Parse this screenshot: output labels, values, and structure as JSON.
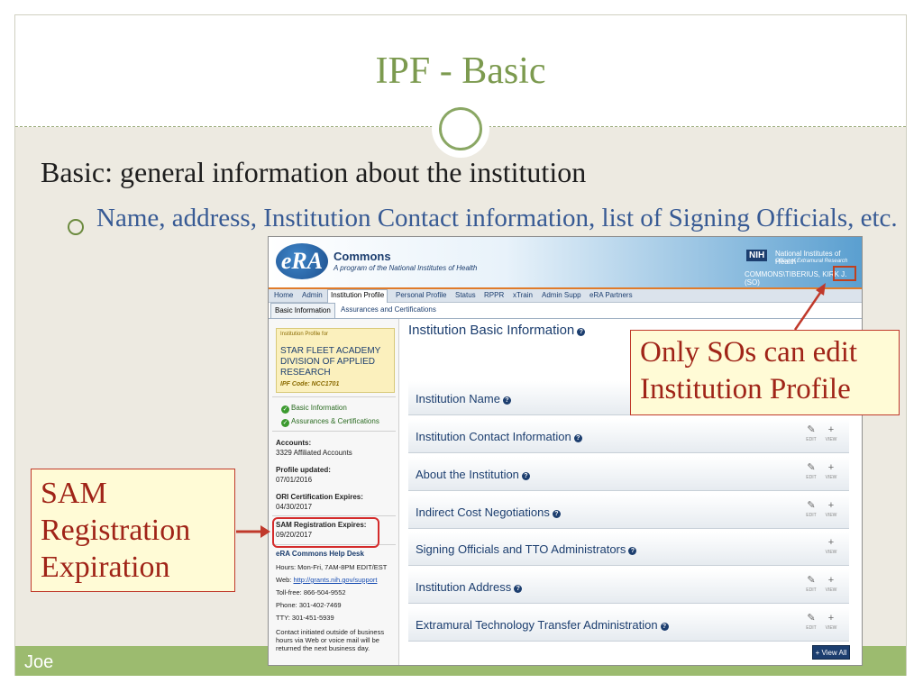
{
  "slide": {
    "title": "IPF - Basic",
    "heading": "Basic: general information about the institution",
    "bullet": "Name, address, Institution Contact information, list of Signing Officials, etc.",
    "footer": "Joe"
  },
  "era": {
    "logo": "eRA",
    "app_name": "Commons",
    "tagline": "A program of the National Institutes of Health",
    "nih_badge": "NIH",
    "nih_name": "National Institutes of Health",
    "nih_office": "Office of Extramural Research",
    "user": "COMMONS\\TIBERIUS, KIRK J. (SO)",
    "nav": [
      "Home",
      "Admin",
      "Institution Profile",
      "Personal Profile",
      "Status",
      "RPPR",
      "xTrain",
      "Admin Supp",
      "eRA Partners"
    ],
    "subtabs": [
      "Basic Information",
      "Assurances and Certifications"
    ],
    "left": {
      "profile_label": "Institution Profile for",
      "institution_name": "STAR FLEET ACADEMY DIVISION OF APPLIED RESEARCH",
      "ipf_code": "IPF Code: NCC1701",
      "links": [
        "Basic Information",
        "Assurances & Certifications"
      ],
      "accounts_label": "Accounts:",
      "accounts_value": "3329 Affiliated Accounts",
      "updated_label": "Profile updated:",
      "updated_value": "07/01/2016",
      "ori_label": "ORI Certification Expires:",
      "ori_value": "04/30/2017",
      "sam_label": "SAM Registration Expires:",
      "sam_value": "09/20/2017",
      "help_title": "eRA Commons Help Desk",
      "help_hours": "Hours: Mon-Fri, 7AM-8PM EDIT/EST",
      "help_web_label": "Web:",
      "help_web_link": "http://grants.nih.gov/support",
      "help_tollfree": "Toll-free: 866-504-9552",
      "help_phone": "Phone: 301-402-7469",
      "help_tty": "TTY: 301-451-5939",
      "help_note": "Contact initiated outside of business hours via Web or voice mail will be returned the next business day."
    },
    "main": {
      "title": "Institution Basic Information",
      "sections": [
        {
          "title": "Institution Name",
          "edit": false,
          "view": false
        },
        {
          "title": "Institution Contact Information",
          "edit": true,
          "view": true
        },
        {
          "title": "About the Institution",
          "edit": true,
          "view": true
        },
        {
          "title": "Indirect Cost Negotiations",
          "edit": true,
          "view": true
        },
        {
          "title": "Signing Officials and TTO Administrators",
          "edit": false,
          "view": true
        },
        {
          "title": "Institution Address",
          "edit": true,
          "view": true
        },
        {
          "title": "Extramural Technology Transfer Administration",
          "edit": true,
          "view": true
        }
      ],
      "edit_label": "EDIT",
      "view_label": "VIEW",
      "help_glyph": "?",
      "view_all": "+ View All"
    }
  },
  "callouts": {
    "so_line1": "Only SOs can edit",
    "so_line2": "Institution Profile",
    "sam_line1": "SAM",
    "sam_line2": "Registration",
    "sam_line3": "Expiration"
  },
  "colors": {
    "title_green": "#7c9a4f",
    "bullet_blue": "#375a94",
    "callout_red": "#c0392b",
    "footer_green": "#9cbb6f"
  }
}
